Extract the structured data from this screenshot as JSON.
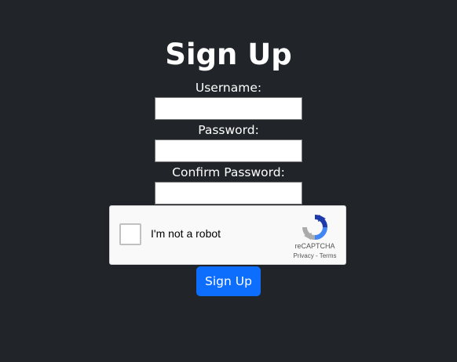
{
  "page": {
    "title": "Sign Up",
    "background_color": "#212529"
  },
  "form": {
    "username_label": "Username:",
    "username_value": "",
    "password_label": "Password:",
    "password_value": "",
    "confirm_label": "Confirm Password:",
    "confirm_value": "",
    "submit_label": "Sign Up",
    "submit_color": "#0d6efd"
  },
  "recaptcha": {
    "checkbox_label": "I'm not a robot",
    "checked": false,
    "brand": "reCAPTCHA",
    "privacy_link": "Privacy",
    "separator": "-",
    "terms_link": "Terms",
    "logo_icon": "recaptcha-logo-icon"
  }
}
